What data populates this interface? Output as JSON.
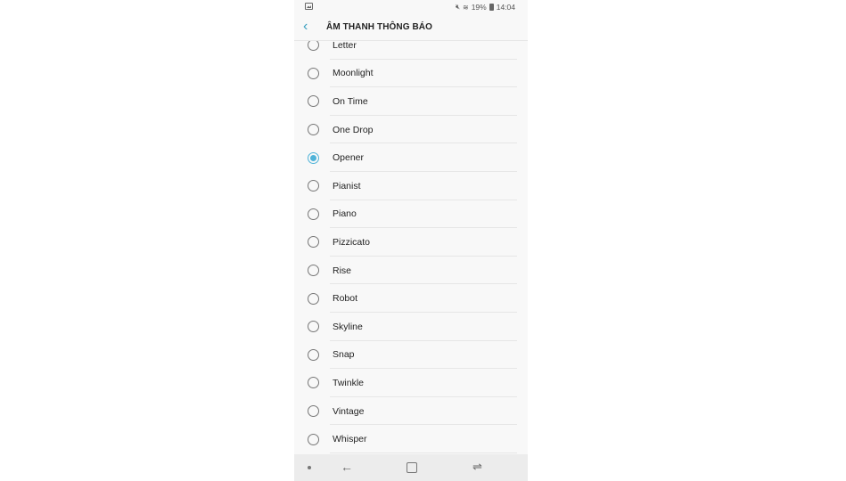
{
  "status_bar": {
    "gallery_icon": "image-icon",
    "mute_icon": "mute-icon",
    "wifi_icon": "wifi-icon",
    "battery_percent": "19%",
    "battery_icon": "battery-icon",
    "time": "14:04"
  },
  "header": {
    "back_icon": "chevron-left-icon",
    "back_glyph": "‹",
    "title": "ÂM THANH THÔNG BÁO"
  },
  "accent_color": "#4fb3d8",
  "sounds": {
    "selected": "Opener",
    "items": [
      {
        "label": "Letter",
        "checked": false
      },
      {
        "label": "Moonlight",
        "checked": false
      },
      {
        "label": "On Time",
        "checked": false
      },
      {
        "label": "One Drop",
        "checked": false
      },
      {
        "label": "Opener",
        "checked": true
      },
      {
        "label": "Pianist",
        "checked": false
      },
      {
        "label": "Piano",
        "checked": false
      },
      {
        "label": "Pizzicato",
        "checked": false
      },
      {
        "label": "Rise",
        "checked": false
      },
      {
        "label": "Robot",
        "checked": false
      },
      {
        "label": "Skyline",
        "checked": false
      },
      {
        "label": "Snap",
        "checked": false
      },
      {
        "label": "Twinkle",
        "checked": false
      },
      {
        "label": "Vintage",
        "checked": false
      },
      {
        "label": "Whisper",
        "checked": false
      }
    ]
  },
  "nav_bar": {
    "dot_icon": "nav-dot-icon",
    "back_glyph": "←",
    "home_icon": "home-square-icon",
    "recent_glyph": "⇌"
  }
}
